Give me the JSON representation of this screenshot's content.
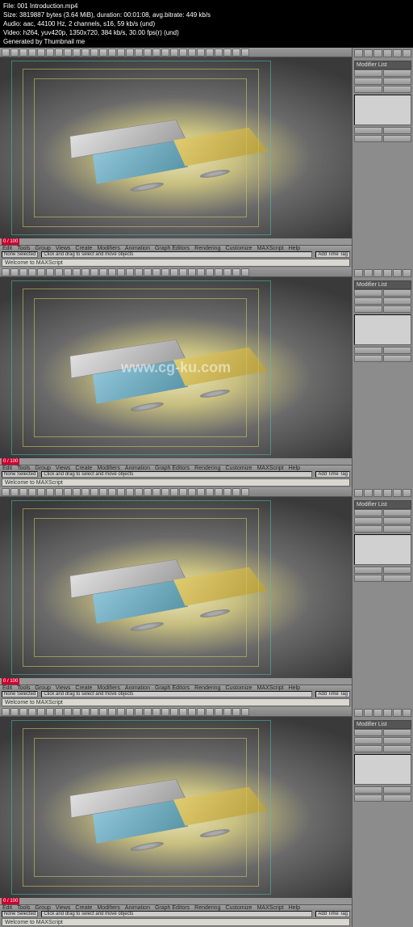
{
  "meta": {
    "file": "File: 001 Introduction.mp4",
    "size": "Size: 3819887 bytes (3.64 MiB), duration: 00:01:08, avg.bitrate: 449 kb/s",
    "audio": "Audio: aac, 44100 Hz, 2 channels, s16, 59 kb/s (und)",
    "video": "Video: h264, yuv420p, 1350x720, 384 kb/s, 30.00 fps(r) (und)",
    "gen": "Generated by Thumbnail me"
  },
  "menu": {
    "items": [
      "Edit",
      "Tools",
      "Group",
      "Views",
      "Create",
      "Modifiers",
      "Animation",
      "Graph Editors",
      "Rendering",
      "Customize",
      "MAXScript",
      "Help"
    ]
  },
  "panel": {
    "header": "Modifier List"
  },
  "console": {
    "welcome": "Welcome to MAXScript",
    "hint": "Click and drag to select and move objects"
  },
  "status": {
    "selection": "None Selected",
    "frame": "0 / 100",
    "timeTag": "Add Time Tag"
  },
  "watermark": "www.cg-ku.com",
  "frames": [
    {
      "watermark": false
    },
    {
      "watermark": true
    },
    {
      "watermark": false
    },
    {
      "watermark": false
    }
  ]
}
